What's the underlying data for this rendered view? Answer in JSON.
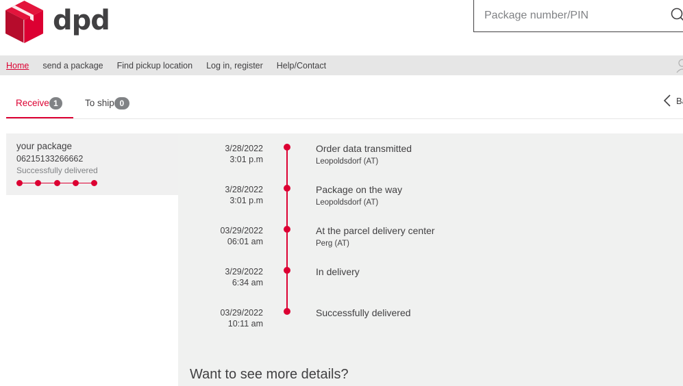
{
  "brand": {
    "logo_text": "dpd",
    "accent": "#dc0032",
    "dark": "#414042"
  },
  "search": {
    "placeholder": "Package number/PIN",
    "icon": "search-icon"
  },
  "nav": {
    "items": [
      {
        "label": "Home",
        "active": true
      },
      {
        "label": "send a package"
      },
      {
        "label": "Find pickup location"
      },
      {
        "label": "Log in, register"
      },
      {
        "label": "Help/Contact"
      }
    ]
  },
  "tabs": [
    {
      "label": "Receive",
      "count": "1",
      "active": true
    },
    {
      "label": "To ship",
      "count": "0"
    }
  ],
  "back_label": "Ba",
  "package": {
    "title": "your package",
    "number": "06215133266662",
    "status": "Successfully delivered",
    "progress_steps_completed": 5,
    "progress_steps_total": 5
  },
  "events": [
    {
      "date": "3/28/2022",
      "time": "3:01 p.m",
      "title": "Order data transmitted",
      "location": "Leopoldsdorf (AT)"
    },
    {
      "date": "3/28/2022",
      "time": "3:01 p.m",
      "title": "Package on the way",
      "location": "Leopoldsdorf (AT)"
    },
    {
      "date": "03/29/2022",
      "time": "06:01 am",
      "title": "At the parcel delivery center",
      "location": "Perg (AT)"
    },
    {
      "date": "3/29/2022",
      "time": "6:34 am",
      "title": "In delivery",
      "location": ""
    },
    {
      "date": "03/29/2022",
      "time": "10:11 am",
      "title": "Successfully delivered",
      "location": ""
    }
  ],
  "more_details": "Want to see more details?"
}
